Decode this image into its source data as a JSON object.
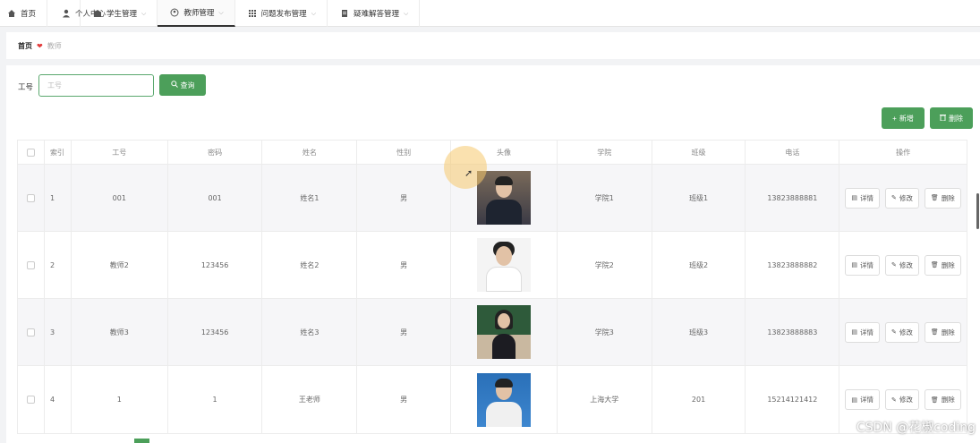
{
  "nav": {
    "items": [
      {
        "label": "首页",
        "icon": "home-icon",
        "has_chevron": false
      },
      {
        "label": "个人中心",
        "icon": "user-icon",
        "has_chevron": true
      },
      {
        "label": "学生管理",
        "icon": "student-icon",
        "has_chevron": true
      },
      {
        "label": "教师管理",
        "icon": "teacher-icon",
        "has_chevron": true,
        "active": true
      },
      {
        "label": "问题发布管理",
        "icon": "grid-icon",
        "has_chevron": true
      },
      {
        "label": "疑难解答管理",
        "icon": "doc-icon",
        "has_chevron": true
      }
    ]
  },
  "breadcrumb": {
    "home": "首页",
    "current": "教师"
  },
  "search": {
    "label": "工号",
    "placeholder": "工号",
    "button": "查询"
  },
  "actions": {
    "add": "新增",
    "delete": "删除"
  },
  "table": {
    "columns": [
      "索引",
      "工号",
      "密码",
      "姓名",
      "性别",
      "头像",
      "学院",
      "班级",
      "电话",
      "操作"
    ],
    "rows": [
      {
        "index": "1",
        "no": "001",
        "password": "001",
        "name": "姓名1",
        "gender": "男",
        "avatar": "male-teacher-suit",
        "college": "学院1",
        "class": "班级1",
        "phone": "13823888881"
      },
      {
        "index": "2",
        "no": "教师2",
        "password": "123456",
        "name": "姓名2",
        "gender": "男",
        "avatar": "female-teacher-glasses",
        "college": "学院2",
        "class": "班级2",
        "phone": "13823888882"
      },
      {
        "index": "3",
        "no": "教师3",
        "password": "123456",
        "name": "姓名3",
        "gender": "男",
        "avatar": "female-teacher-blackboard",
        "college": "学院3",
        "class": "班级3",
        "phone": "13823888883"
      },
      {
        "index": "4",
        "no": "1",
        "password": "1",
        "name": "王老师",
        "gender": "男",
        "avatar": "male-teacher-blue-bg",
        "college": "上海大学",
        "class": "201",
        "phone": "15214121412"
      }
    ],
    "row_actions": {
      "detail": "详情",
      "edit": "修改",
      "delete": "删除"
    }
  },
  "watermark": "CSDN @花椒coding",
  "colors": {
    "accent": "#4c9f5a",
    "heart": "#e23b3b"
  }
}
